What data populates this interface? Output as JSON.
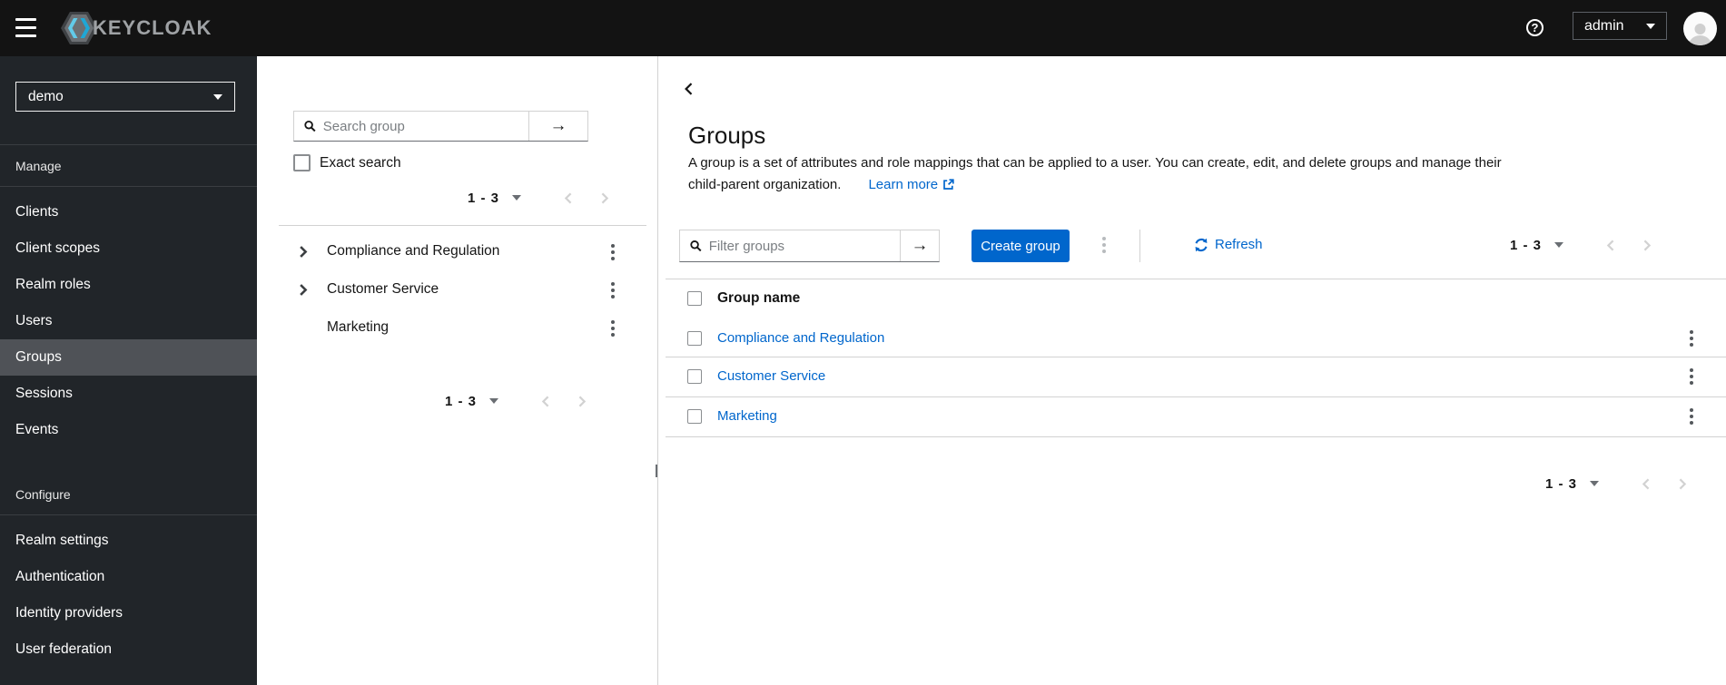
{
  "masthead": {
    "brand": "KEYCLOAK",
    "help_glyph": "?",
    "username": "admin"
  },
  "sidebar": {
    "realm": "demo",
    "sections": [
      {
        "label": "Manage",
        "items": [
          "Clients",
          "Client scopes",
          "Realm roles",
          "Users",
          "Groups",
          "Sessions",
          "Events"
        ],
        "active_item": "Groups"
      },
      {
        "label": "Configure",
        "items": [
          "Realm settings",
          "Authentication",
          "Identity providers",
          "User federation"
        ]
      }
    ]
  },
  "tree": {
    "search_placeholder": "Search group",
    "exact_label": "Exact search",
    "pager_top": {
      "range": "1 - 3"
    },
    "items": [
      {
        "name": "Compliance and Regulation",
        "expandable": true
      },
      {
        "name": "Customer Service",
        "expandable": true
      },
      {
        "name": "Marketing",
        "expandable": false
      }
    ],
    "pager_bottom": {
      "range": "1 - 3"
    }
  },
  "main": {
    "title": "Groups",
    "description": {
      "line1": "A group is a set of attributes and role mappings that can be applied to a user. You can create, edit, and delete groups and manage their",
      "line2": "child-parent organization.",
      "learn_more_label": "Learn more"
    },
    "toolbar": {
      "filter_placeholder": "Filter groups",
      "create_label": "Create group",
      "refresh_label": "Refresh",
      "pager": {
        "range": "1 - 3"
      }
    },
    "table": {
      "header": "Group name",
      "rows": [
        "Compliance and Regulation",
        "Customer Service",
        "Marketing"
      ]
    },
    "pager_bottom": {
      "range": "1 - 3"
    }
  },
  "icons": {
    "menu": "hamburger-bars",
    "brand_mark": "hexagon-double-chevron",
    "help": "question-mark-circle",
    "user_menu": "caret-down",
    "avatar": "person-silhouette",
    "search": "magnifier",
    "submit_search": "arrow-right",
    "expand_row": "angle-right",
    "collapse_drawer": "angle-left",
    "options": "kebab-vertical-dots",
    "pager_prev": "angle-left",
    "pager_next": "angle-right",
    "external_link": "box-with-arrow",
    "refresh": "circular-sync-arrows"
  },
  "colors": {
    "primary": "#0066cc",
    "link": "#0066cc",
    "masthead_bg": "#131313",
    "sidebar_bg": "#212529",
    "sidebar_active_bg": "#4f5257",
    "border": "#d2d2d2",
    "text": "#151515",
    "muted": "#6a6e73"
  }
}
